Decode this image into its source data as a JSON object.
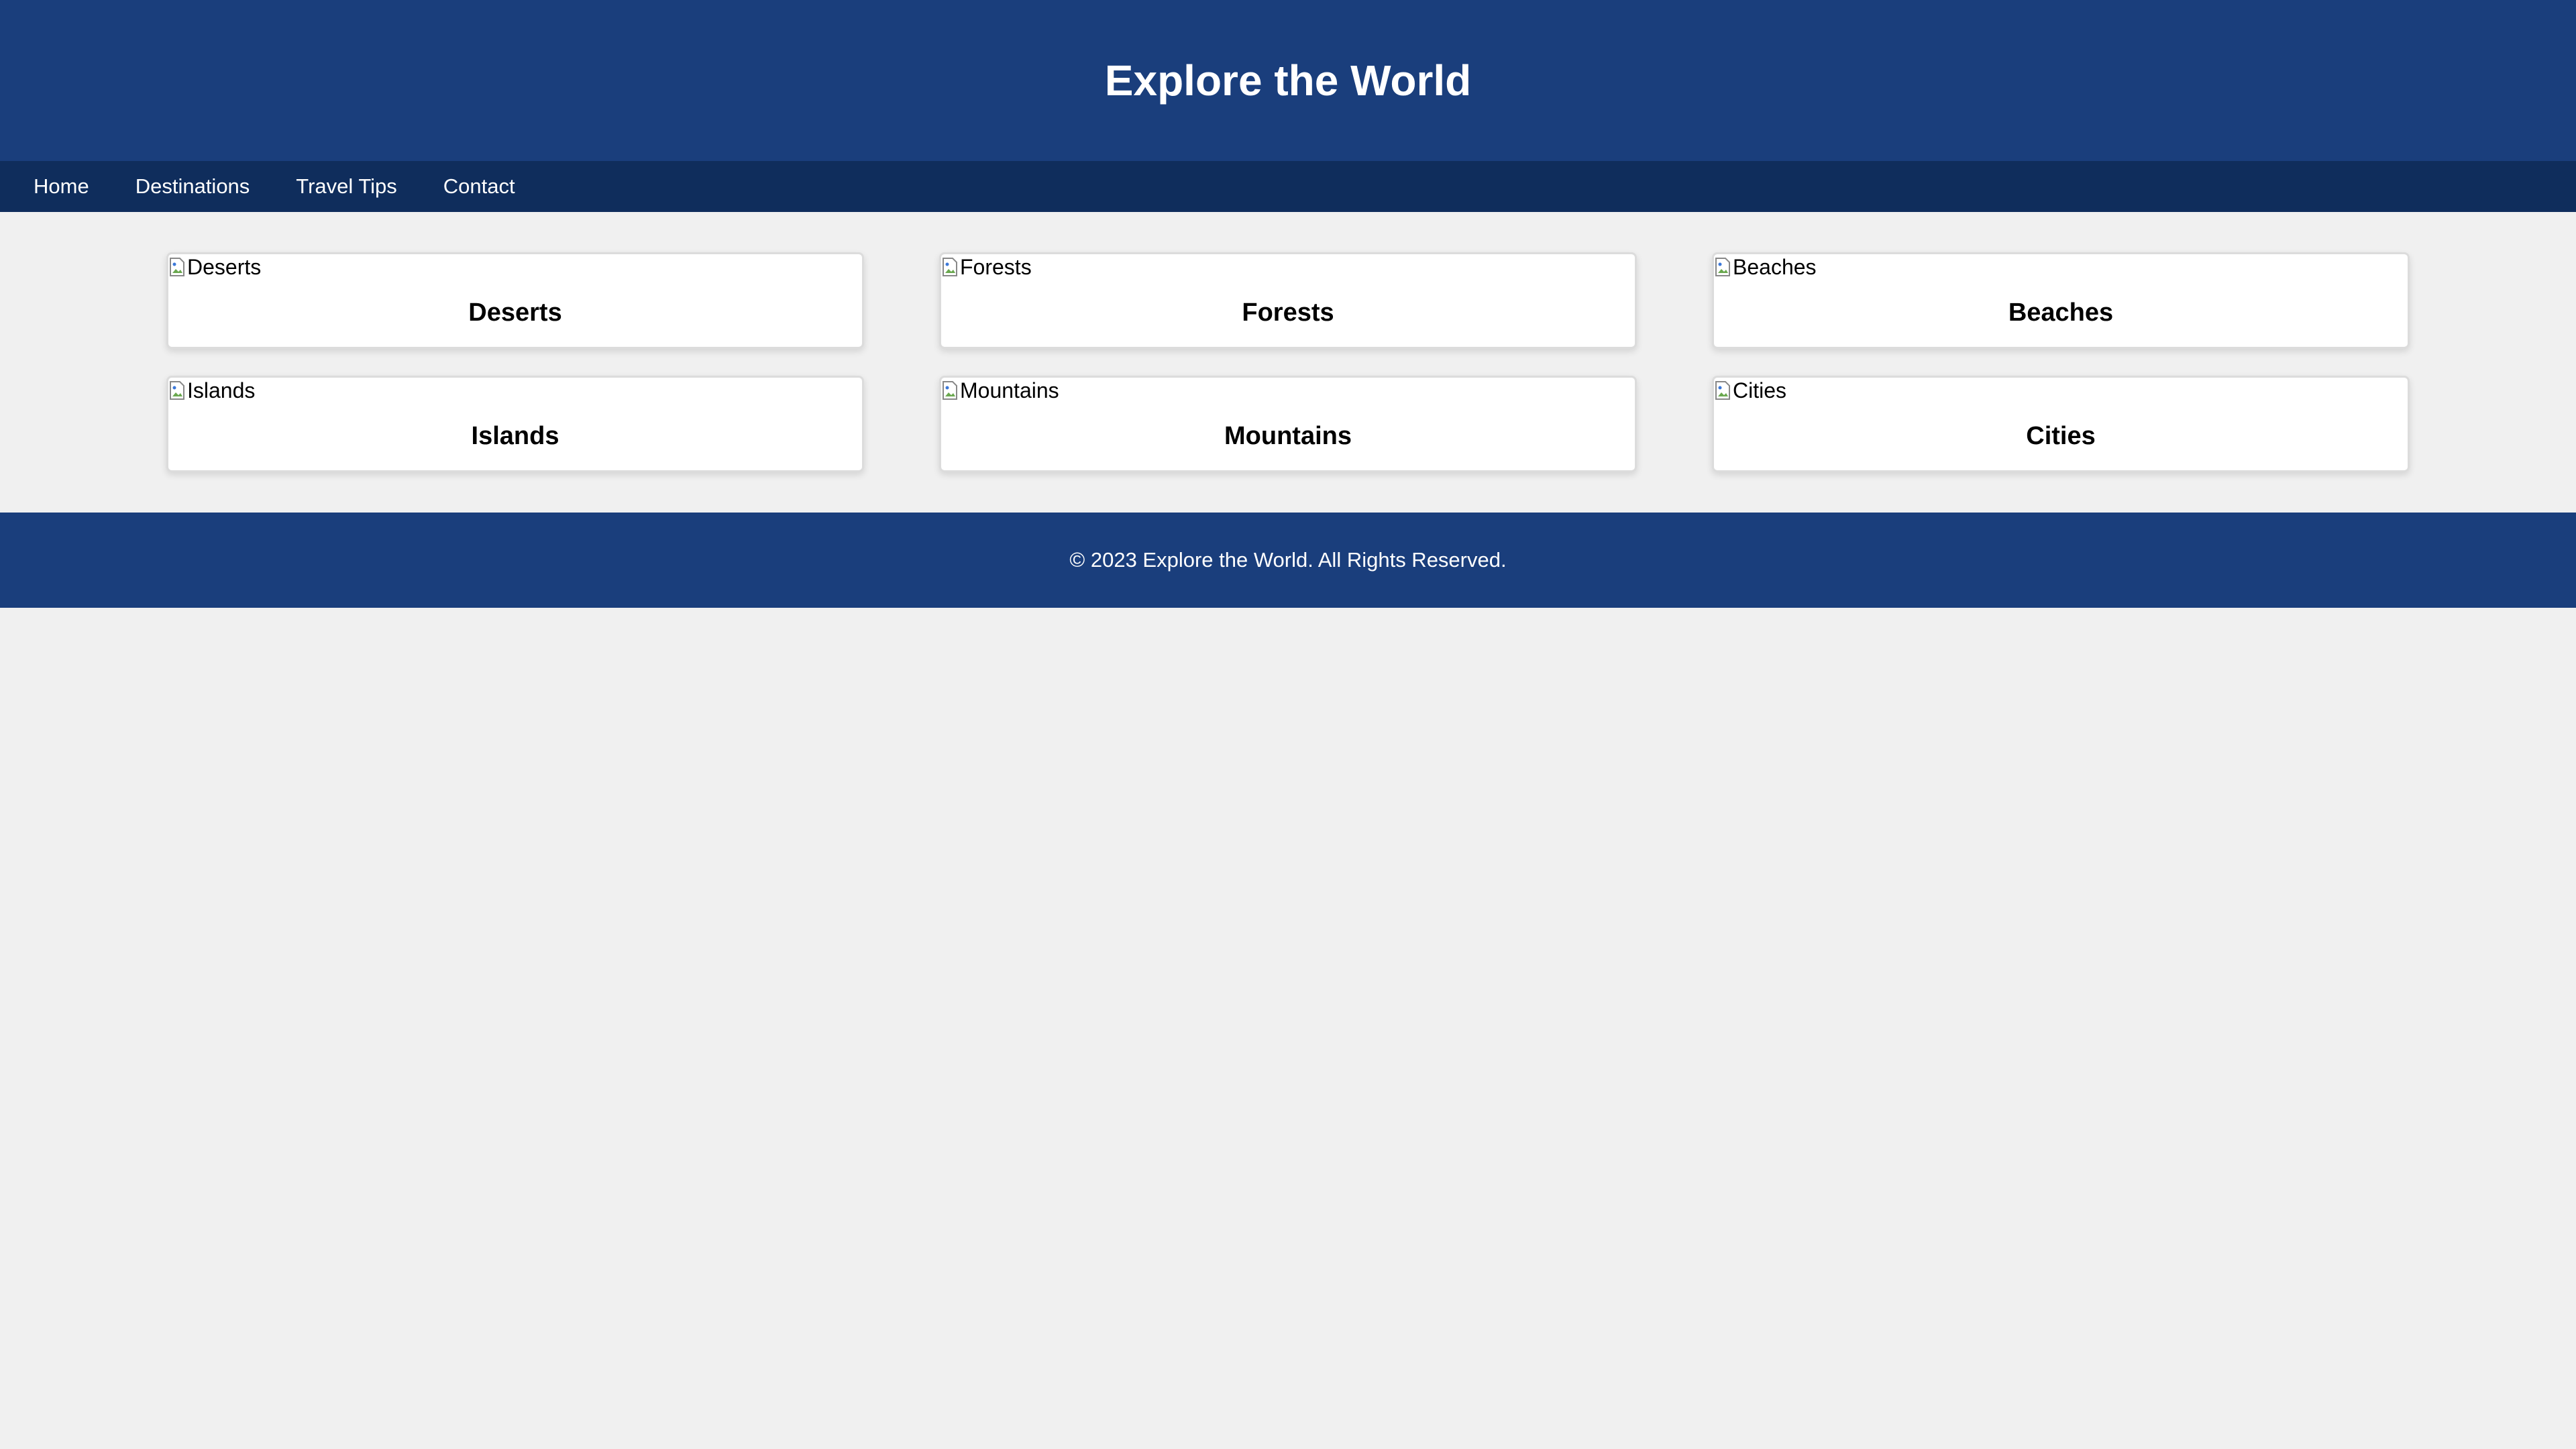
{
  "header": {
    "title": "Explore the World",
    "background_color": "#1a3e7c"
  },
  "nav": {
    "background_color": "#0f2d5c",
    "items": [
      {
        "label": "Home"
      },
      {
        "label": "Destinations"
      },
      {
        "label": "Travel Tips"
      },
      {
        "label": "Contact"
      }
    ]
  },
  "cards": [
    {
      "image_alt": "Deserts",
      "title": "Deserts"
    },
    {
      "image_alt": "Forests",
      "title": "Forests"
    },
    {
      "image_alt": "Beaches",
      "title": "Beaches"
    },
    {
      "image_alt": "Islands",
      "title": "Islands"
    },
    {
      "image_alt": "Mountains",
      "title": "Mountains"
    },
    {
      "image_alt": "Cities",
      "title": "Cities"
    }
  ],
  "icons": {
    "card_image": "broken-image-icon"
  },
  "footer": {
    "text": "© 2023 Explore the World. All Rights Reserved."
  }
}
